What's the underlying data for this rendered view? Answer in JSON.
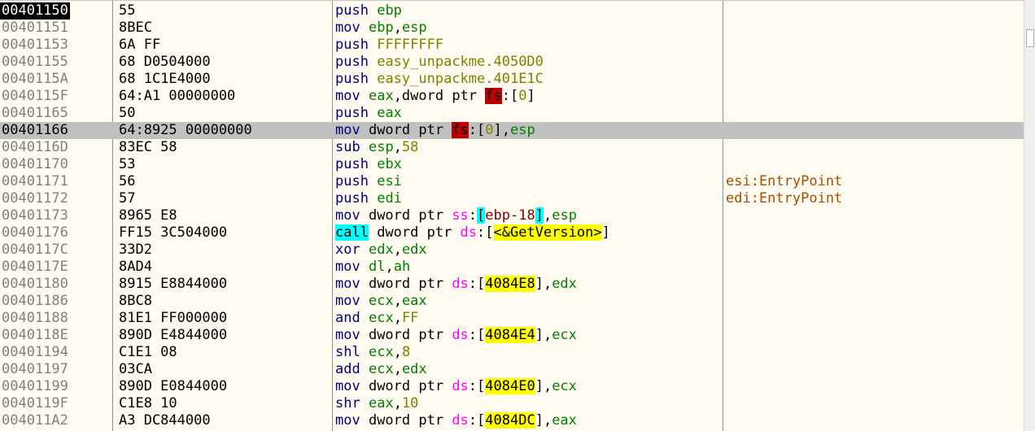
{
  "colors": {
    "background": "#fffbf0",
    "current_row": "#c0c0c0",
    "eip_address_bg": "#000000",
    "mnemonic": "#000080",
    "register": "#008000",
    "immediate": "#808000",
    "segment": "#ff00ff",
    "fs_highlight": "#c00000",
    "memory_highlight": "#ffff00",
    "call_highlight": "#00ffff",
    "comment": "#a05000"
  },
  "icons": {
    "scrollbar": "scroll-thumb"
  },
  "rows": [
    {
      "address": "00401150",
      "bytes": "55",
      "eip": true,
      "current": false,
      "comment": "",
      "instr": [
        {
          "t": "push",
          "c": "mn"
        },
        {
          "t": " ",
          "c": "tk"
        },
        {
          "t": "ebp",
          "c": "reg"
        }
      ]
    },
    {
      "address": "00401151",
      "bytes": "8BEC",
      "eip": false,
      "current": false,
      "comment": "",
      "instr": [
        {
          "t": "mov",
          "c": "mn"
        },
        {
          "t": " ",
          "c": "tk"
        },
        {
          "t": "ebp",
          "c": "reg"
        },
        {
          "t": ",",
          "c": "tk"
        },
        {
          "t": "esp",
          "c": "reg"
        }
      ]
    },
    {
      "address": "00401153",
      "bytes": "6A FF",
      "eip": false,
      "current": false,
      "comment": "",
      "instr": [
        {
          "t": "push",
          "c": "mn"
        },
        {
          "t": " ",
          "c": "tk"
        },
        {
          "t": "FFFFFFFF",
          "c": "imm"
        }
      ]
    },
    {
      "address": "00401155",
      "bytes": "68 D0504000",
      "eip": false,
      "current": false,
      "comment": "",
      "instr": [
        {
          "t": "push",
          "c": "mn"
        },
        {
          "t": " ",
          "c": "tk"
        },
        {
          "t": "easy_unpackme.4050D0",
          "c": "imm"
        }
      ]
    },
    {
      "address": "0040115A",
      "bytes": "68 1C1E4000",
      "eip": false,
      "current": false,
      "comment": "",
      "instr": [
        {
          "t": "push",
          "c": "mn"
        },
        {
          "t": " ",
          "c": "tk"
        },
        {
          "t": "easy_unpackme.401E1C",
          "c": "imm"
        }
      ]
    },
    {
      "address": "0040115F",
      "bytes": "64:A1 00000000",
      "eip": false,
      "current": false,
      "comment": "",
      "instr": [
        {
          "t": "mov",
          "c": "mn"
        },
        {
          "t": " ",
          "c": "tk"
        },
        {
          "t": "eax",
          "c": "reg"
        },
        {
          "t": ",dword ptr ",
          "c": "tk"
        },
        {
          "t": "fs",
          "c": "seg-fs"
        },
        {
          "t": ":[",
          "c": "tk"
        },
        {
          "t": "0",
          "c": "imm"
        },
        {
          "t": "]",
          "c": "tk"
        }
      ]
    },
    {
      "address": "00401165",
      "bytes": "50",
      "eip": false,
      "current": false,
      "comment": "",
      "instr": [
        {
          "t": "push",
          "c": "mn"
        },
        {
          "t": " ",
          "c": "tk"
        },
        {
          "t": "eax",
          "c": "reg"
        }
      ]
    },
    {
      "address": "00401166",
      "bytes": "64:8925 00000000",
      "eip": false,
      "current": true,
      "comment": "",
      "instr": [
        {
          "t": "mov",
          "c": "mn"
        },
        {
          "t": " dword ptr ",
          "c": "tk"
        },
        {
          "t": "fs",
          "c": "seg-fs"
        },
        {
          "t": ":[",
          "c": "tk"
        },
        {
          "t": "0",
          "c": "imm"
        },
        {
          "t": "],",
          "c": "tk"
        },
        {
          "t": "esp",
          "c": "reg"
        }
      ]
    },
    {
      "address": "0040116D",
      "bytes": "83EC 58",
      "eip": false,
      "current": false,
      "comment": "",
      "instr": [
        {
          "t": "sub",
          "c": "mn"
        },
        {
          "t": " ",
          "c": "tk"
        },
        {
          "t": "esp",
          "c": "reg"
        },
        {
          "t": ",",
          "c": "tk"
        },
        {
          "t": "58",
          "c": "imm"
        }
      ]
    },
    {
      "address": "00401170",
      "bytes": "53",
      "eip": false,
      "current": false,
      "comment": "",
      "instr": [
        {
          "t": "push",
          "c": "mn"
        },
        {
          "t": " ",
          "c": "tk"
        },
        {
          "t": "ebx",
          "c": "reg"
        }
      ]
    },
    {
      "address": "00401171",
      "bytes": "56",
      "eip": false,
      "current": false,
      "comment": "esi:EntryPoint",
      "instr": [
        {
          "t": "push",
          "c": "mn"
        },
        {
          "t": " ",
          "c": "tk"
        },
        {
          "t": "esi",
          "c": "reg"
        }
      ]
    },
    {
      "address": "00401172",
      "bytes": "57",
      "eip": false,
      "current": false,
      "comment": "edi:EntryPoint",
      "instr": [
        {
          "t": "push",
          "c": "mn"
        },
        {
          "t": " ",
          "c": "tk"
        },
        {
          "t": "edi",
          "c": "reg"
        }
      ]
    },
    {
      "address": "00401173",
      "bytes": "8965 E8",
      "eip": false,
      "current": false,
      "comment": "",
      "instr": [
        {
          "t": "mov",
          "c": "mn"
        },
        {
          "t": " dword ptr ",
          "c": "tk"
        },
        {
          "t": "ss",
          "c": "seg"
        },
        {
          "t": ":",
          "c": "tk"
        },
        {
          "t": "[",
          "c": "brk-ss"
        },
        {
          "t": "ebp-18",
          "c": "memreg"
        },
        {
          "t": "]",
          "c": "brk-ss"
        },
        {
          "t": ",",
          "c": "tk"
        },
        {
          "t": "esp",
          "c": "reg"
        }
      ]
    },
    {
      "address": "00401176",
      "bytes": "FF15 3C504000",
      "eip": false,
      "current": false,
      "comment": "",
      "instr": [
        {
          "t": "call",
          "c": "mn-call"
        },
        {
          "t": " dword ptr ",
          "c": "tk"
        },
        {
          "t": "ds",
          "c": "seg"
        },
        {
          "t": ":[",
          "c": "tk"
        },
        {
          "t": "<&GetVersion>",
          "c": "mem"
        },
        {
          "t": "]",
          "c": "tk"
        }
      ]
    },
    {
      "address": "0040117C",
      "bytes": "33D2",
      "eip": false,
      "current": false,
      "comment": "",
      "instr": [
        {
          "t": "xor",
          "c": "mn"
        },
        {
          "t": " ",
          "c": "tk"
        },
        {
          "t": "edx",
          "c": "reg"
        },
        {
          "t": ",",
          "c": "tk"
        },
        {
          "t": "edx",
          "c": "reg"
        }
      ]
    },
    {
      "address": "0040117E",
      "bytes": "8AD4",
      "eip": false,
      "current": false,
      "comment": "",
      "instr": [
        {
          "t": "mov",
          "c": "mn"
        },
        {
          "t": " ",
          "c": "tk"
        },
        {
          "t": "dl",
          "c": "reg"
        },
        {
          "t": ",",
          "c": "tk"
        },
        {
          "t": "ah",
          "c": "reg"
        }
      ]
    },
    {
      "address": "00401180",
      "bytes": "8915 E8844000",
      "eip": false,
      "current": false,
      "comment": "",
      "instr": [
        {
          "t": "mov",
          "c": "mn"
        },
        {
          "t": " dword ptr ",
          "c": "tk"
        },
        {
          "t": "ds",
          "c": "seg"
        },
        {
          "t": ":[",
          "c": "tk"
        },
        {
          "t": "4084E8",
          "c": "mem"
        },
        {
          "t": "],",
          "c": "tk"
        },
        {
          "t": "edx",
          "c": "reg"
        }
      ]
    },
    {
      "address": "00401186",
      "bytes": "8BC8",
      "eip": false,
      "current": false,
      "comment": "",
      "instr": [
        {
          "t": "mov",
          "c": "mn"
        },
        {
          "t": " ",
          "c": "tk"
        },
        {
          "t": "ecx",
          "c": "reg"
        },
        {
          "t": ",",
          "c": "tk"
        },
        {
          "t": "eax",
          "c": "reg"
        }
      ]
    },
    {
      "address": "00401188",
      "bytes": "81E1 FF000000",
      "eip": false,
      "current": false,
      "comment": "",
      "instr": [
        {
          "t": "and",
          "c": "mn"
        },
        {
          "t": " ",
          "c": "tk"
        },
        {
          "t": "ecx",
          "c": "reg"
        },
        {
          "t": ",",
          "c": "tk"
        },
        {
          "t": "FF",
          "c": "imm"
        }
      ]
    },
    {
      "address": "0040118E",
      "bytes": "890D E4844000",
      "eip": false,
      "current": false,
      "comment": "",
      "instr": [
        {
          "t": "mov",
          "c": "mn"
        },
        {
          "t": " dword ptr ",
          "c": "tk"
        },
        {
          "t": "ds",
          "c": "seg"
        },
        {
          "t": ":[",
          "c": "tk"
        },
        {
          "t": "4084E4",
          "c": "mem"
        },
        {
          "t": "],",
          "c": "tk"
        },
        {
          "t": "ecx",
          "c": "reg"
        }
      ]
    },
    {
      "address": "00401194",
      "bytes": "C1E1 08",
      "eip": false,
      "current": false,
      "comment": "",
      "instr": [
        {
          "t": "shl",
          "c": "mn"
        },
        {
          "t": " ",
          "c": "tk"
        },
        {
          "t": "ecx",
          "c": "reg"
        },
        {
          "t": ",",
          "c": "tk"
        },
        {
          "t": "8",
          "c": "imm"
        }
      ]
    },
    {
      "address": "00401197",
      "bytes": "03CA",
      "eip": false,
      "current": false,
      "comment": "",
      "instr": [
        {
          "t": "add",
          "c": "mn"
        },
        {
          "t": " ",
          "c": "tk"
        },
        {
          "t": "ecx",
          "c": "reg"
        },
        {
          "t": ",",
          "c": "tk"
        },
        {
          "t": "edx",
          "c": "reg"
        }
      ]
    },
    {
      "address": "00401199",
      "bytes": "890D E0844000",
      "eip": false,
      "current": false,
      "comment": "",
      "instr": [
        {
          "t": "mov",
          "c": "mn"
        },
        {
          "t": " dword ptr ",
          "c": "tk"
        },
        {
          "t": "ds",
          "c": "seg"
        },
        {
          "t": ":[",
          "c": "tk"
        },
        {
          "t": "4084E0",
          "c": "mem"
        },
        {
          "t": "],",
          "c": "tk"
        },
        {
          "t": "ecx",
          "c": "reg"
        }
      ]
    },
    {
      "address": "0040119F",
      "bytes": "C1E8 10",
      "eip": false,
      "current": false,
      "comment": "",
      "instr": [
        {
          "t": "shr",
          "c": "mn"
        },
        {
          "t": " ",
          "c": "tk"
        },
        {
          "t": "eax",
          "c": "reg"
        },
        {
          "t": ",",
          "c": "tk"
        },
        {
          "t": "10",
          "c": "imm"
        }
      ]
    },
    {
      "address": "004011A2",
      "bytes": "A3 DC844000",
      "eip": false,
      "current": false,
      "comment": "",
      "instr": [
        {
          "t": "mov",
          "c": "mn"
        },
        {
          "t": " dword ptr ",
          "c": "tk"
        },
        {
          "t": "ds",
          "c": "seg"
        },
        {
          "t": ":[",
          "c": "tk"
        },
        {
          "t": "4084DC",
          "c": "mem"
        },
        {
          "t": "],",
          "c": "tk"
        },
        {
          "t": "eax",
          "c": "reg"
        }
      ]
    }
  ]
}
